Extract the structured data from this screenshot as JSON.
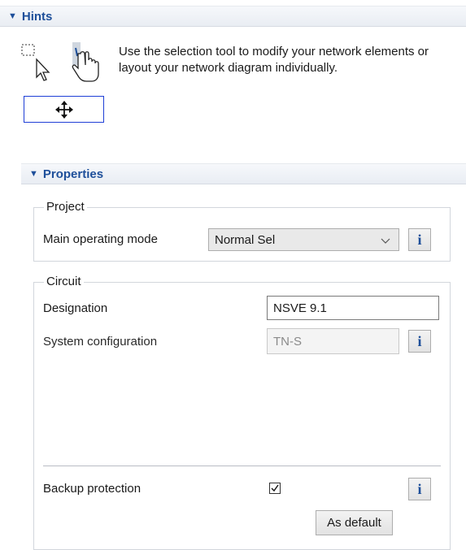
{
  "hints": {
    "title": "Hints",
    "text": "Use the selection tool to modify your network elements or layout your network diagram individually."
  },
  "properties": {
    "title": "Properties",
    "project": {
      "legend": "Project",
      "main_operating_mode_label": "Main operating mode",
      "main_operating_mode_value": "Normal Sel",
      "info_label": "i"
    },
    "circuit": {
      "legend": "Circuit",
      "designation_label": "Designation",
      "designation_value": "NSVE 9.1",
      "system_configuration_label": "System configuration",
      "system_configuration_value": "TN-S",
      "info_label": "i",
      "backup_protection_label": "Backup protection",
      "backup_protection_checked": true,
      "backup_info_label": "i",
      "as_default_label": "As default"
    }
  },
  "colors": {
    "header_text": "#1e4f9a",
    "header_bg": "#eef1f5",
    "selection_box": "#1f3fd6"
  }
}
